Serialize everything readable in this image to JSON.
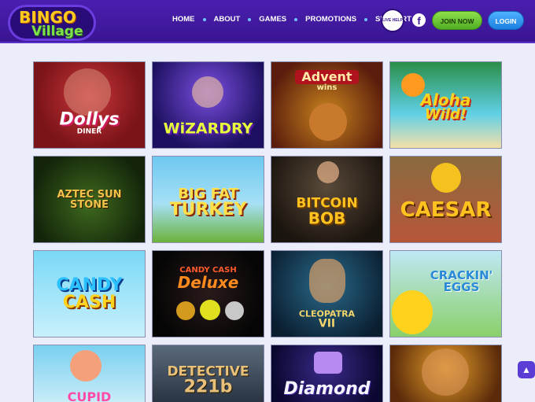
{
  "header": {
    "logo_top": "BINGO",
    "logo_bottom": "Village",
    "nav": [
      "HOME",
      "ABOUT",
      "GAMES",
      "PROMOTIONS",
      "SUPPORT"
    ],
    "live_help": "LIVE HELP",
    "facebook_icon": "f",
    "join_label": "JOIN NOW",
    "login_label": "LOGIN"
  },
  "games": [
    {
      "title": "Dollys",
      "subtitle": "DINER"
    },
    {
      "title": "WiZARDRY",
      "subtitle": ""
    },
    {
      "title": "Advent",
      "subtitle": "wins"
    },
    {
      "title": "Aloha",
      "subtitle": "Wild!"
    },
    {
      "title": "AZTEC SUN STONE",
      "subtitle": ""
    },
    {
      "title": "BIG FAT",
      "subtitle": "TURKEY"
    },
    {
      "title": "BITCOIN",
      "subtitle": "BOB"
    },
    {
      "title": "CAESAR",
      "subtitle": ""
    },
    {
      "title": "CANDY",
      "subtitle": "CASH"
    },
    {
      "title": "CANDY CASH",
      "subtitle": "Deluxe"
    },
    {
      "title": "CLEOPATRA",
      "subtitle": "VII"
    },
    {
      "title": "CRACKIN'",
      "subtitle": "EGGS"
    },
    {
      "title": "CUPID",
      "subtitle": ""
    },
    {
      "title": "DETECTIVE",
      "subtitle": "221b"
    },
    {
      "title": "Diamond",
      "subtitle": ""
    },
    {
      "title": "",
      "subtitle": ""
    }
  ],
  "scroll_top_icon": "arrow-up-icon"
}
